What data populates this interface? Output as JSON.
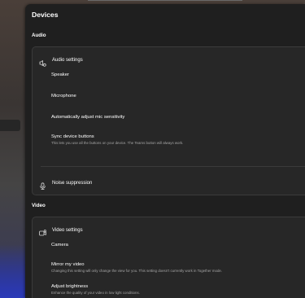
{
  "page": {
    "title": "Devices"
  },
  "audio": {
    "section_label": "Audio",
    "settings_label": "Audio settings",
    "items": [
      {
        "title": "Speaker",
        "subtitle": ""
      },
      {
        "title": "Microphone",
        "subtitle": ""
      },
      {
        "title": "Automatically adjust mic sensitivity",
        "subtitle": ""
      },
      {
        "title": "Sync device buttons",
        "subtitle": "This lets you use all the buttons on your device. The Teams button will always work."
      }
    ],
    "noise_label": "Noise suppression"
  },
  "video": {
    "section_label": "Video",
    "settings_label": "Video settings",
    "items": [
      {
        "title": "Camera",
        "subtitle": ""
      },
      {
        "title": "Mirror my video",
        "subtitle": "Changing this setting will only change the view for you. This setting doesn't currently work in Together mode."
      },
      {
        "title": "Adjust brightness",
        "subtitle": "Enhance the quality of your video in low light conditions."
      }
    ]
  },
  "icons": {
    "audio": "speaker-settings-icon",
    "noise": "noise-suppression-icon",
    "video": "video-settings-icon"
  },
  "colors": {
    "panel": "#1f1f1f",
    "card": "#272727",
    "secondary_text": "#a5a5a5"
  }
}
